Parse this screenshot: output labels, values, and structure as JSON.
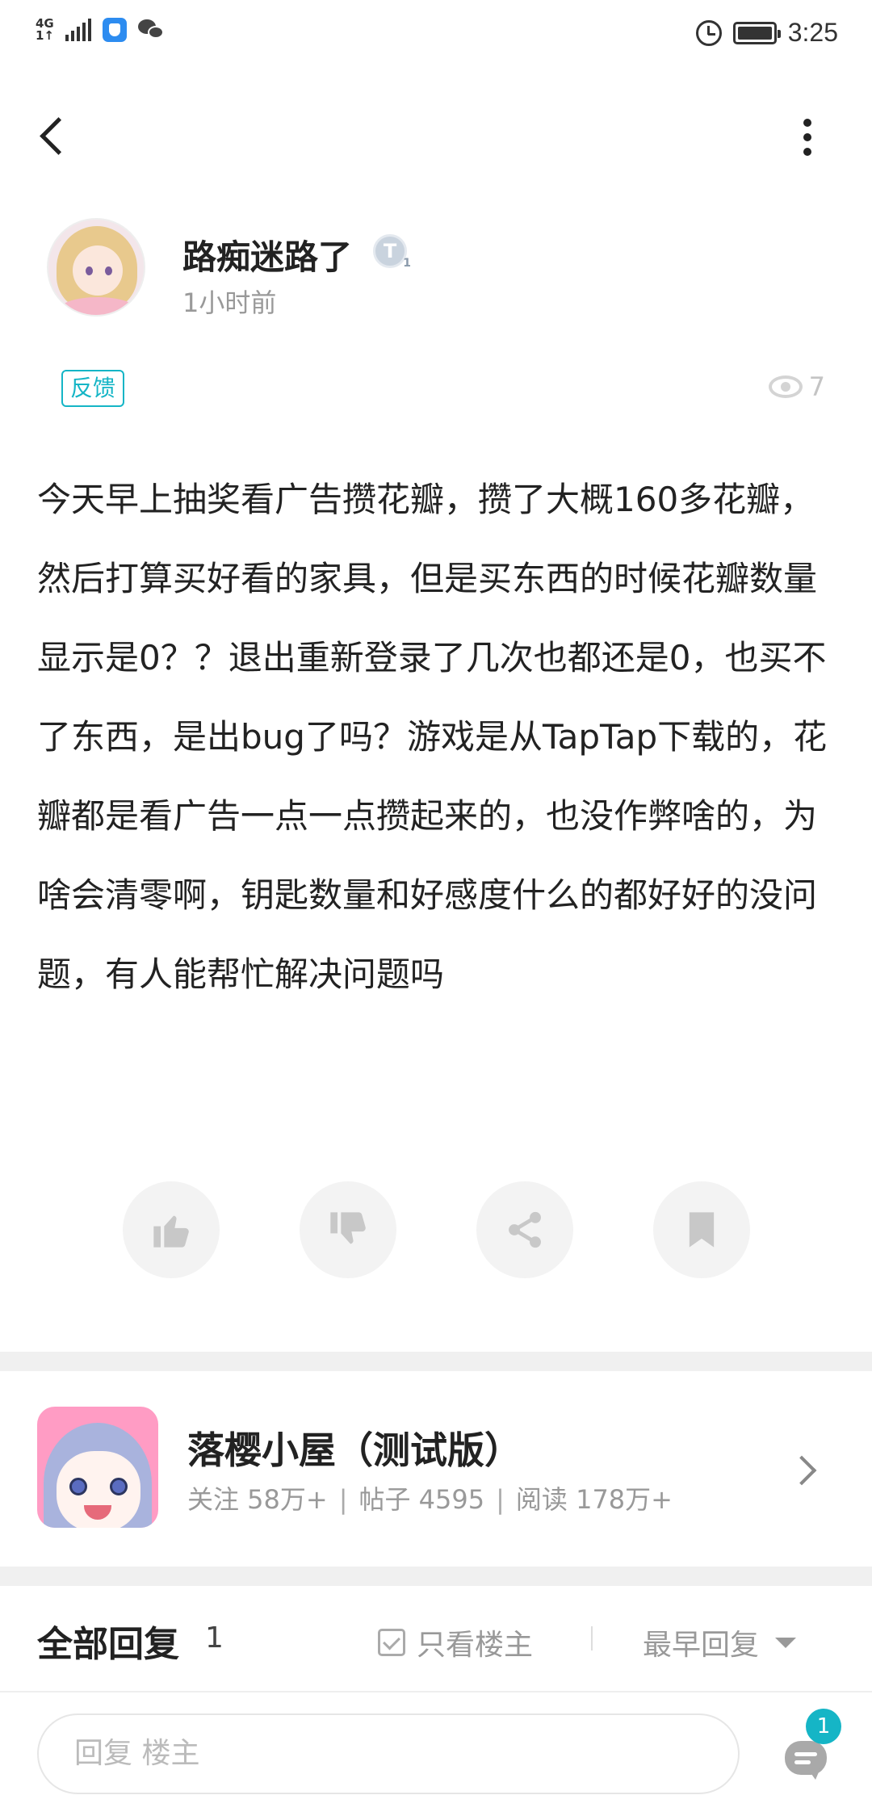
{
  "status_bar": {
    "network": "4G",
    "network_sub": "1↑",
    "time": "3:25",
    "icons": [
      "signal-icon",
      "app-badge-icon",
      "wechat-icon",
      "alarm-icon",
      "battery-icon"
    ]
  },
  "nav": {
    "back_icon": "back-arrow-icon",
    "more_icon": "more-vertical-icon"
  },
  "author": {
    "name": "路痴迷路了",
    "badge_letter": "T",
    "badge_level": "1",
    "time": "1小时前"
  },
  "post": {
    "tag": "反馈",
    "views": "7",
    "body": "今天早上抽奖看广告攒花瓣，攒了大概160多花瓣，然后打算买好看的家具，但是买东西的时候花瓣数量显示是0？？退出重新登录了几次也都还是0，也买不了东西，是出bug了吗？游戏是从TapTap下载的，花瓣都是看广告一点一点攒起来的，也没作弊啥的，为啥会清零啊，钥匙数量和好感度什么的都好好的没问题，有人能帮忙解决问题吗"
  },
  "actions": [
    "like-icon",
    "dislike-icon",
    "share-icon",
    "bookmark-icon"
  ],
  "forum": {
    "name": "落樱小屋（测试版）",
    "followers_label": "关注 58万+",
    "posts_label": "帖子 4595",
    "reads_label": "阅读 178万+"
  },
  "replies": {
    "title": "全部回复",
    "count": "1",
    "only_op_label": "只看楼主",
    "sort_label": "最早回复"
  },
  "reply_bar": {
    "placeholder": "回复  楼主",
    "comment_badge": "1"
  },
  "colors": {
    "accent": "#15b5c6",
    "text_primary": "#222222",
    "text_secondary": "#999999",
    "divider": "#f0f0f0"
  }
}
